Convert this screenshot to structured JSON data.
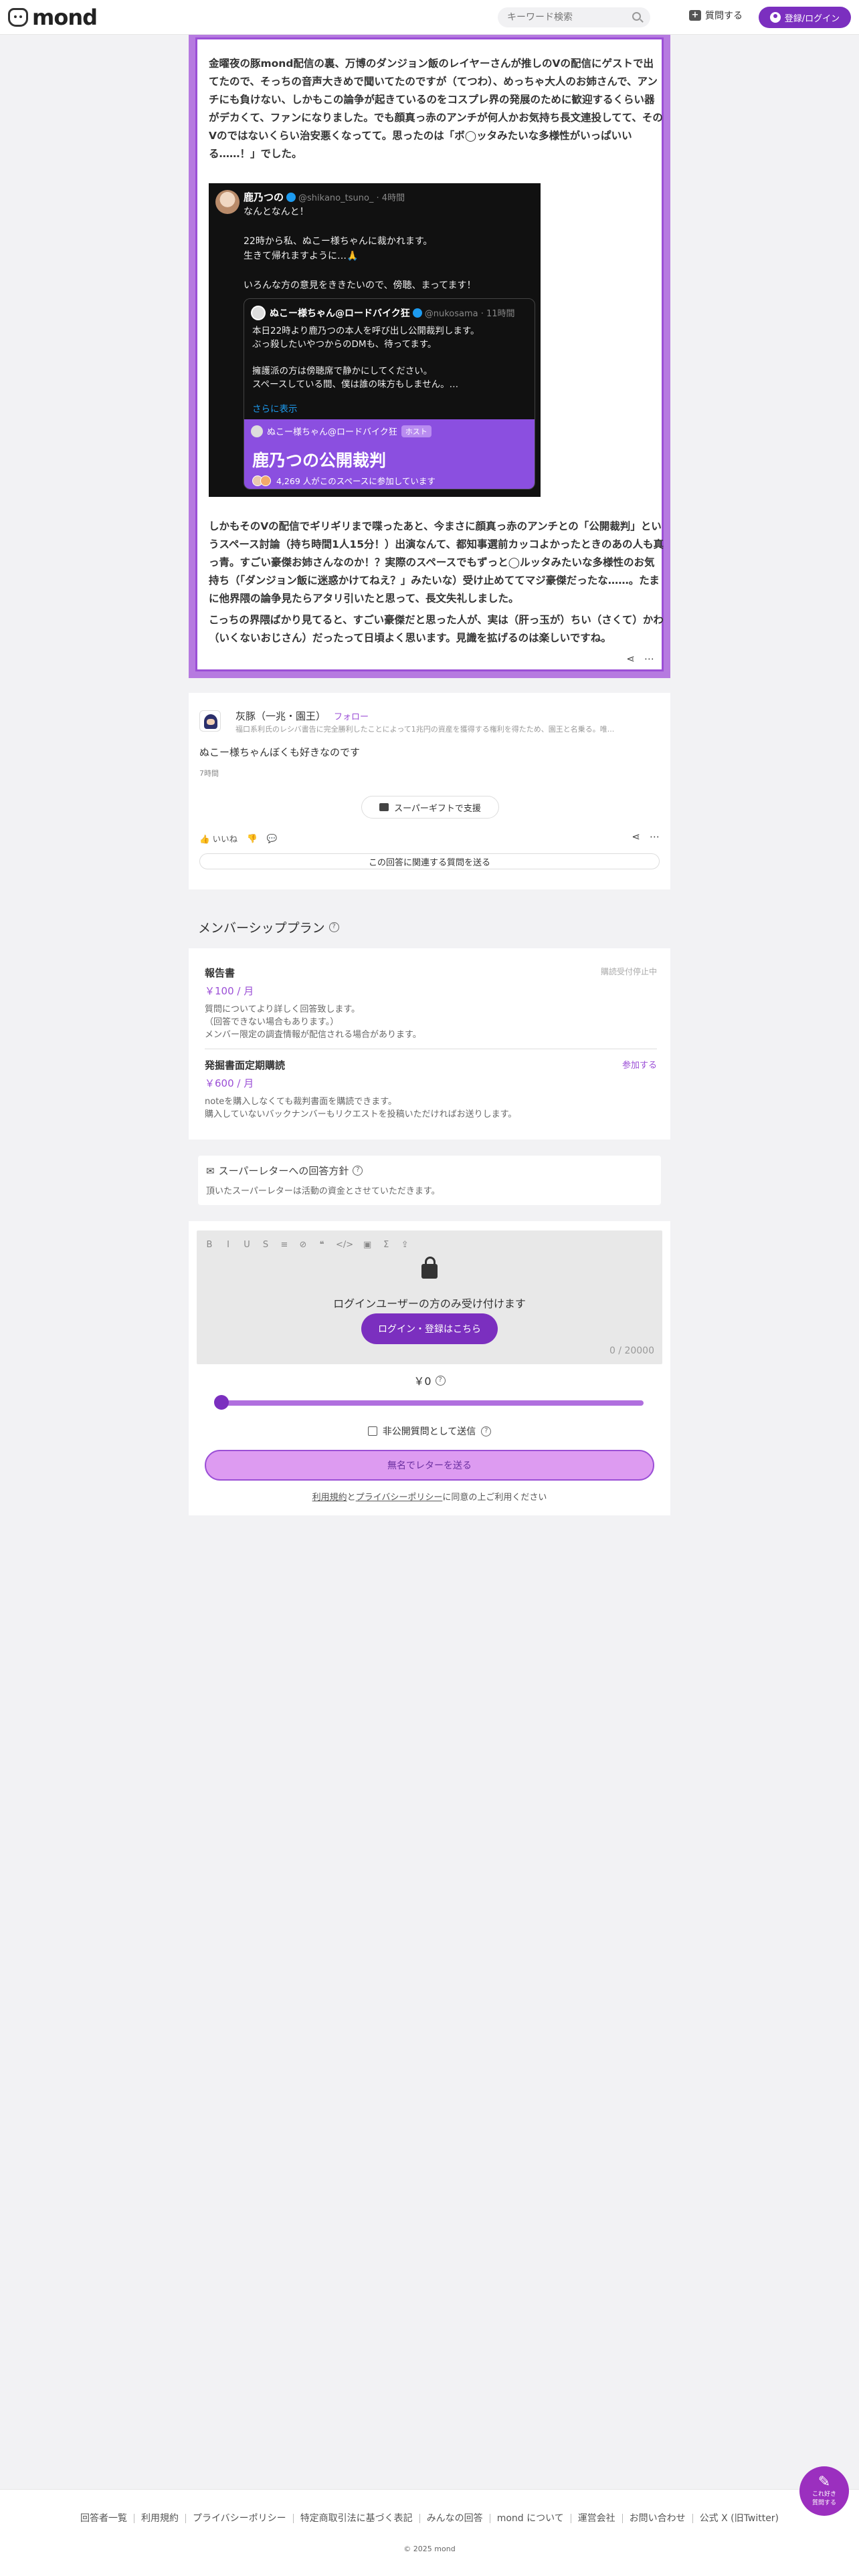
{
  "header": {
    "logo_text": "mond",
    "search_placeholder": "キーワード検索",
    "ask_label": "質問する",
    "login_label": "登録/ログイン"
  },
  "answer": {
    "para1": "金曜夜の豚mond配信の裏、万博のダンジョン飯のレイヤーさんが推しのVの配信にゲストで出てたので、そっちの音声大きめで聞いてたのですが（てつわ）、めっちゃ大人のお姉さんで、アンチにも負けない、しかもこの論争が起きているのをコスプレ界の発展のために歓迎するくらい器がデカくて、ファンになりました。でも顔真っ赤のアンチが何人かお気持ち長文連投してて、そのVのではないくらい治安悪くなってて。思ったのは「ボ◯ッタみたいな多様性がいっぱいいる……！」でした。",
    "para2": "しかもそのVの配信でギリギリまで喋ったあと、今まさに顔真っ赤のアンチとの「公開裁判」というスペース討論（持ち時間1人15分！）出演なんて、都知事選前カッコよかったときのあの人も真っ青。すごい豪傑お姉さんなのか！？実際のスペースでもずっと◯ルッタみたいな多様性のお気持ち（「ダンジョン飯に迷惑かけてねえ？」みたいな）受け止めててマジ豪傑だったな……。たまに他界隈の論争見たらアタリ引いたと思って、長文失礼しました。",
    "para3": "こっちの界隈ばかり見てると、すごい豪傑だと思った人が、実は（肝っ玉が）ちい（さくて）かわ（いくないおじさん）だったって日頃よく思います。見識を拡げるのは楽しいですね。"
  },
  "tweet": {
    "name": "鹿乃つの",
    "handle": "@shikano_tsuno_ · 4時間",
    "body": "なんとなんと！\n\n22時から私、ぬこー様ちゃんに裁かれます。\n生きて帰れますように…🙏\n\nいろんな方の意見をききたいので、傍聴、まってます！",
    "quote_name": "ぬこー様ちゃん@ロードバイク狂",
    "quote_handle": "@nukosama · 11時間",
    "quote_body": "本日22時より鹿乃つの本人を呼び出し公開裁判します。\nぶっ殺したいやつからのDMも、待ってます。\n\n擁護派の方は傍聴席で静かにしてください。\nスペースしている間、僕は誰の味方もしません。…",
    "quote_more": "さらに表示",
    "space_host": "ぬこー様ちゃん@ロードバイク狂",
    "space_host_tag": "ホスト",
    "space_title": "鹿乃つの公開裁判",
    "space_listeners": "4,269 人がこのスペースに参加しています"
  },
  "comment": {
    "name": "灰豚（一兆・園王）",
    "follow": "フォロー",
    "bio": "福口系利氏のレシバ書告に完全勝利したことによって1兆円の資産を獲得する権利を得たため、園王と名乗る。唯...",
    "text": "ぬこー様ちゃんぼくも好きなのです",
    "time": "7時間",
    "gift_label": "スーパーギフトで支援",
    "like_label": "いいね",
    "related_label": "この回答に関連する質問を送る"
  },
  "membership": {
    "heading": "メンバーシッププラン",
    "plans": [
      {
        "title": "報告書",
        "price": "￥100 / 月",
        "desc": "質問についてより詳しく回答致します。\n（回答できない場合もあります。）\nメンバー限定の調査情報が配信される場合があります。",
        "status": "購読受付停止中"
      },
      {
        "title": "発掘書面定期購読",
        "price": "￥600 / 月",
        "desc": "noteを購入しなくても裁判書面を購読できます。\n購入していないバックナンバーもリクエストを投稿いただければお送りします。",
        "status": "参加する"
      }
    ]
  },
  "policy": {
    "title": "スーパーレターへの回答方針",
    "desc": "頂いたスーパーレターは活動の資金とさせていただきます。"
  },
  "letter": {
    "toolbar": [
      "B",
      "I",
      "U",
      "S",
      "≡",
      "⊘",
      "❝",
      "</>",
      "▣",
      "Σ",
      "⇪"
    ],
    "lock_message": "ログインユーザーの方のみ受け付けます",
    "login_button": "ログイン・登録はこちら",
    "char_count": "0 / 20000",
    "amount": "￥0",
    "private_label": "非公開質問として送信",
    "send_button": "無名でレターを送る",
    "agree_terms": "利用規約",
    "agree_and": "と",
    "agree_privacy": "プライバシーポリシー",
    "agree_suffix": "に同意の上ご利用ください"
  },
  "fab": {
    "label_line1": "これ好き",
    "label_line2": "質問する"
  },
  "footer": {
    "links": [
      "回答者一覧",
      "利用規約",
      "プライバシーポリシー",
      "特定商取引法に基づく表記",
      "みんなの回答",
      "mond について",
      "運営会社",
      "お問い合わせ",
      "公式 X (旧Twitter)"
    ],
    "copyright": "© 2025 mond"
  },
  "colors": {
    "accent": "#7b2fbf",
    "accent_light": "#b67ae0",
    "space_purple": "#8b4fe0"
  }
}
